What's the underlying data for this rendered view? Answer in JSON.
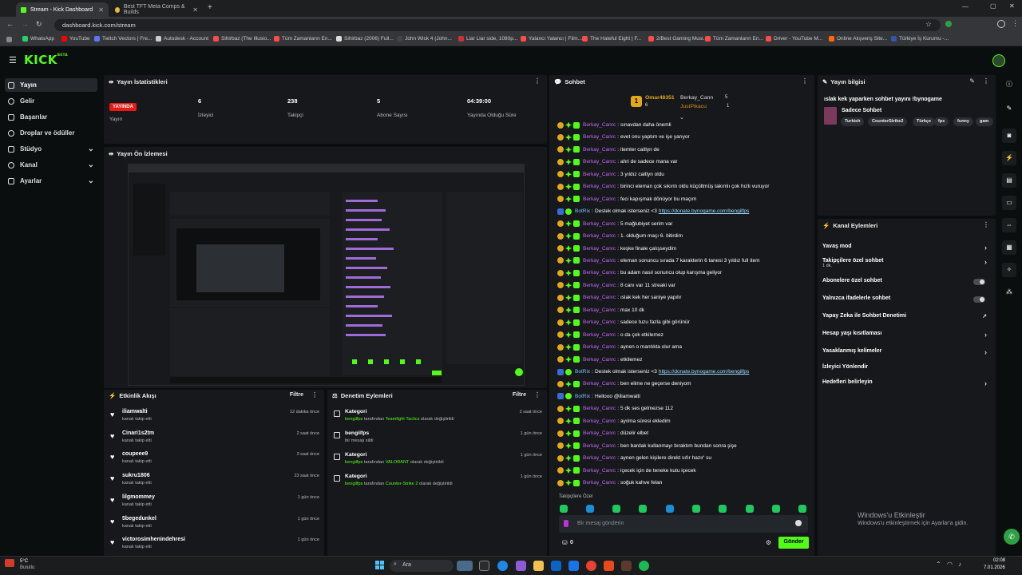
{
  "browser": {
    "tabs": [
      {
        "label": "Stream - Kick Dashboard",
        "active": true
      },
      {
        "label": "Best TFT Meta Comps & Builds",
        "active": false
      }
    ],
    "url": "dashboard.kick.com/stream",
    "bookmarks": [
      {
        "label": "WhatsApp",
        "color": "#25d366"
      },
      {
        "label": "YouTube",
        "color": "#ff0000"
      },
      {
        "label": "Twitch Vectors | Fre...",
        "color": "#5b76f7"
      },
      {
        "label": "Autodesk - Account",
        "color": "#cccccc"
      },
      {
        "label": "Sihirbaz (The Illusio...",
        "color": "#ff4a4a"
      },
      {
        "label": "Tüm Zamanların En...",
        "color": "#ff4a4a"
      },
      {
        "label": "Sihirbaz (2006) Full...",
        "color": "#dddddd"
      },
      {
        "label": "John Wick 4 (John...",
        "color": "#444444"
      },
      {
        "label": "Liar Liar side, 1080p...",
        "color": "#cc3333"
      },
      {
        "label": "Yalancı Yalancı | Film...",
        "color": "#ff4a4a"
      },
      {
        "label": "The Hateful Eight | F...",
        "color": "#ff4a4a"
      },
      {
        "label": "2/Best Gaming Musi...",
        "color": "#ff4a4a"
      },
      {
        "label": "Tüm Zamanların En...",
        "color": "#ff4a4a"
      },
      {
        "label": "Driver - YouTube M...",
        "color": "#ff4a4a"
      },
      {
        "label": "Online Alışveriş Site...",
        "color": "#ff6a00"
      },
      {
        "label": "Türkiye İş Kurumu -...",
        "color": "#3355aa"
      }
    ]
  },
  "app": {
    "logo": "KICK",
    "logo_badge": "BETA",
    "accent": "#53fc18"
  },
  "sidebar": {
    "items": [
      {
        "label": "Yayın",
        "icon": "broadcast-icon",
        "selected": true
      },
      {
        "label": "Gelir",
        "icon": "income-icon"
      },
      {
        "label": "Başarılar",
        "icon": "trophy-icon"
      },
      {
        "label": "Droplar ve ödüller",
        "icon": "gift-icon"
      },
      {
        "label": "Stüdyo",
        "icon": "studio-icon",
        "expandable": true
      },
      {
        "label": "Kanal",
        "icon": "channel-icon",
        "expandable": true
      },
      {
        "label": "Ayarlar",
        "icon": "gear-icon",
        "expandable": true
      }
    ]
  },
  "stats": {
    "title": "Yayın İstatistikleri",
    "live_badge": "YAYINDA",
    "status_label": "Yayın",
    "viewers": {
      "value": "6",
      "label": "İzleyici"
    },
    "followers": {
      "value": "238",
      "label": "Takipçi"
    },
    "subs": {
      "value": "5",
      "label": "Abone Sayısı"
    },
    "uptime": {
      "value": "04:39:00",
      "label": "Yayında Olduğu Süre"
    }
  },
  "preview": {
    "title": "Yayın Ön İzlemesi"
  },
  "activity": {
    "title": "Etkinlik Akışı",
    "filter": "Filtre",
    "items": [
      {
        "name": "iliamwalti",
        "sub": "kanalı takip etti",
        "time": "12 dakika önce"
      },
      {
        "name": "Cinari1s2tm",
        "sub": "kanalı takip etti",
        "time": "2 saat önce"
      },
      {
        "name": "coupeee9",
        "sub": "kanalı takip etti",
        "time": "3 saat önce"
      },
      {
        "name": "sukru1806",
        "sub": "kanalı takip etti",
        "time": "23 saat önce"
      },
      {
        "name": "lilgmommey",
        "sub": "kanalı takip etti",
        "time": "1 gün önce"
      },
      {
        "name": "5begedunkel",
        "sub": "kanalı takip etti",
        "time": "1 gün önce"
      },
      {
        "name": "victorosimhenindehresi",
        "sub": "kanalı takip etti",
        "time": "1 gün önce"
      }
    ]
  },
  "moderation": {
    "title": "Denetim Eylemleri",
    "filter": "Filtre",
    "items": [
      {
        "title": "Kategori",
        "user": "bengilfps",
        "mid": " tarafından ",
        "target": "Teamfight Tactics",
        "tail": " olarak değiştirildi",
        "time": "2 saat önce"
      },
      {
        "title": "bengilfps",
        "user": "",
        "mid": "",
        "target": "",
        "tail": "bir mesajı sildi",
        "time": "1 gün önce"
      },
      {
        "title": "Kategori",
        "user": "bengilfps",
        "mid": " tarafından ",
        "target": "VALORANT",
        "tail": " olarak değiştirildi",
        "time": "1 gün önce"
      },
      {
        "title": "Kategori",
        "user": "bengilfps",
        "mid": " tarafından ",
        "target": "Counter-Strike 2",
        "tail": " olarak değiştirildi",
        "time": "1 gün önce"
      }
    ]
  },
  "chat": {
    "title": "Sohbet",
    "top_gifter": {
      "rank": "1",
      "name": "Omar48351",
      "count": "6"
    },
    "gifters": [
      {
        "name": "Berkay_Cann",
        "count": "5"
      },
      {
        "name": "JustPikacu",
        "count": "1"
      }
    ],
    "messages": [
      {
        "user": "Berkay_Canrc",
        "text": "sınavdan daha önemli"
      },
      {
        "user": "Berkay_Canrc",
        "text": "evet onu yaptım ve işe yarıyor"
      },
      {
        "user": "Berkay_Canrc",
        "text": "itemler caitlyn de"
      },
      {
        "user": "Berkay_Canrc",
        "text": "ahri de sadece mana var"
      },
      {
        "user": "Berkay_Canrc",
        "text": "3 yıldız caitlyn oldu"
      },
      {
        "user": "Berkay_Canrc",
        "text": "birinci eleman çok sıkıntı oldu küçültmüş takımlı çok hızlı vuruyor"
      },
      {
        "user": "Berkay_Canrc",
        "text": "feci kapışmak dönüyor bu maçım"
      },
      {
        "user": "BotRix",
        "bot": true,
        "text": "Destek olmak isterseniz <3 ",
        "link": "https://donate.bynogame.com/bengilfps"
      },
      {
        "user": "Berkay_Canrc",
        "text": "5 mağlubiyet serim var"
      },
      {
        "user": "Berkay_Canrc",
        "text": "1. olduğum maçı 6. bitirdim"
      },
      {
        "user": "Berkay_Canrc",
        "text": "keşke finale çalışseydim"
      },
      {
        "user": "Berkay_Canrc",
        "text": "eleman sonuncu sırada 7 karakterin 6 tanesi 3 yıldız full item"
      },
      {
        "user": "Berkay_Canrc",
        "text": "bu adam nasıl sonuncu olup karışma geliyor"
      },
      {
        "user": "Berkay_Canrc",
        "text": "8 canı var 11 streaki var"
      },
      {
        "user": "Berkay_Canrc",
        "text": "ıslak kek her saniye yapılır"
      },
      {
        "user": "Berkay_Canrc",
        "text": "max 10 dk"
      },
      {
        "user": "Berkay_Canrc",
        "text": "sadece tuzu fazla gibi görünür"
      },
      {
        "user": "Berkay_Canrc",
        "text": "o da çok etkilemez"
      },
      {
        "user": "Berkay_Canrc",
        "text": "aynen o mantıkta olur ama"
      },
      {
        "user": "Berkay_Canrc",
        "text": "etkilemez"
      },
      {
        "user": "BotRix",
        "bot": true,
        "text": "Destek olmak isterseniz <3 ",
        "link": "https://donate.bynogame.com/bengilfps"
      },
      {
        "user": "Berkay_Canrc",
        "text": "ben elime ne geçerse deniyom"
      },
      {
        "user": "BotRix",
        "bot": true,
        "text": "Hellooo @iliamwalti",
        "link": ""
      },
      {
        "user": "Berkay_Canrc",
        "text": "5 dk ses gelmezse 112"
      },
      {
        "user": "Berkay_Canrc",
        "text": "ayılma süresi ekledim"
      },
      {
        "user": "Berkay_Canrc",
        "text": "düzelir elbet"
      },
      {
        "user": "Berkay_Canrc",
        "text": "ben bardak kullanmayı bıraktım bundan sonra şişe"
      },
      {
        "user": "Berkay_Canrc",
        "text": "aynen gelen kişilere direkt sıfır hazır' su"
      },
      {
        "user": "Berkay_Canrc",
        "text": "içecek için de teneke kutu içecek"
      },
      {
        "user": "Berkay_Canrc",
        "text": "soğuk kahve felan"
      }
    ],
    "followers_only_label": "Takipçilere Özel",
    "input_placeholder": "Bir mesaj gönderin",
    "points": "0",
    "send_label": "Gönder"
  },
  "stream_info": {
    "title": "Yayın bilgisi",
    "stream_title": "ıslak kek yaparken sohbet yayını !bynogame",
    "category": "Sadece Sohbet",
    "tags": [
      "Turkish",
      "CounterStrike2",
      "Türkçe",
      "fps",
      "funny",
      "gam"
    ]
  },
  "channel_actions": {
    "title": "Kanal Eylemleri",
    "items": [
      {
        "label": "Yavaş mod",
        "type": "arrow"
      },
      {
        "label": "Takipçilere özel sohbet",
        "sub": "1 dk.",
        "type": "arrow"
      },
      {
        "label": "Abonelere özel sohbet",
        "type": "toggle"
      },
      {
        "label": "Yalnızca ifadelerle sohbet",
        "type": "toggle"
      },
      {
        "label": "Yapay Zeka ile Sohbet Denetimi",
        "type": "external"
      },
      {
        "label": "Hesap yaşı kısıtlaması",
        "type": "arrow"
      },
      {
        "label": "Yasaklanmış kelimeler",
        "type": "arrow"
      },
      {
        "label": "İzleyici Yönlendir",
        "type": "none"
      },
      {
        "label": "Hedefleri belirleyin",
        "type": "arrow"
      }
    ]
  },
  "windows": {
    "activate_title": "Windows'u Etkinleştir",
    "activate_sub": "Windows'u etkinleştirmek için Ayarlar'a gidin.",
    "weather_temp": "5°C",
    "weather_desc": "Bulutlu",
    "search": "Ara",
    "time": "02:08",
    "date": "7.01.2026"
  }
}
